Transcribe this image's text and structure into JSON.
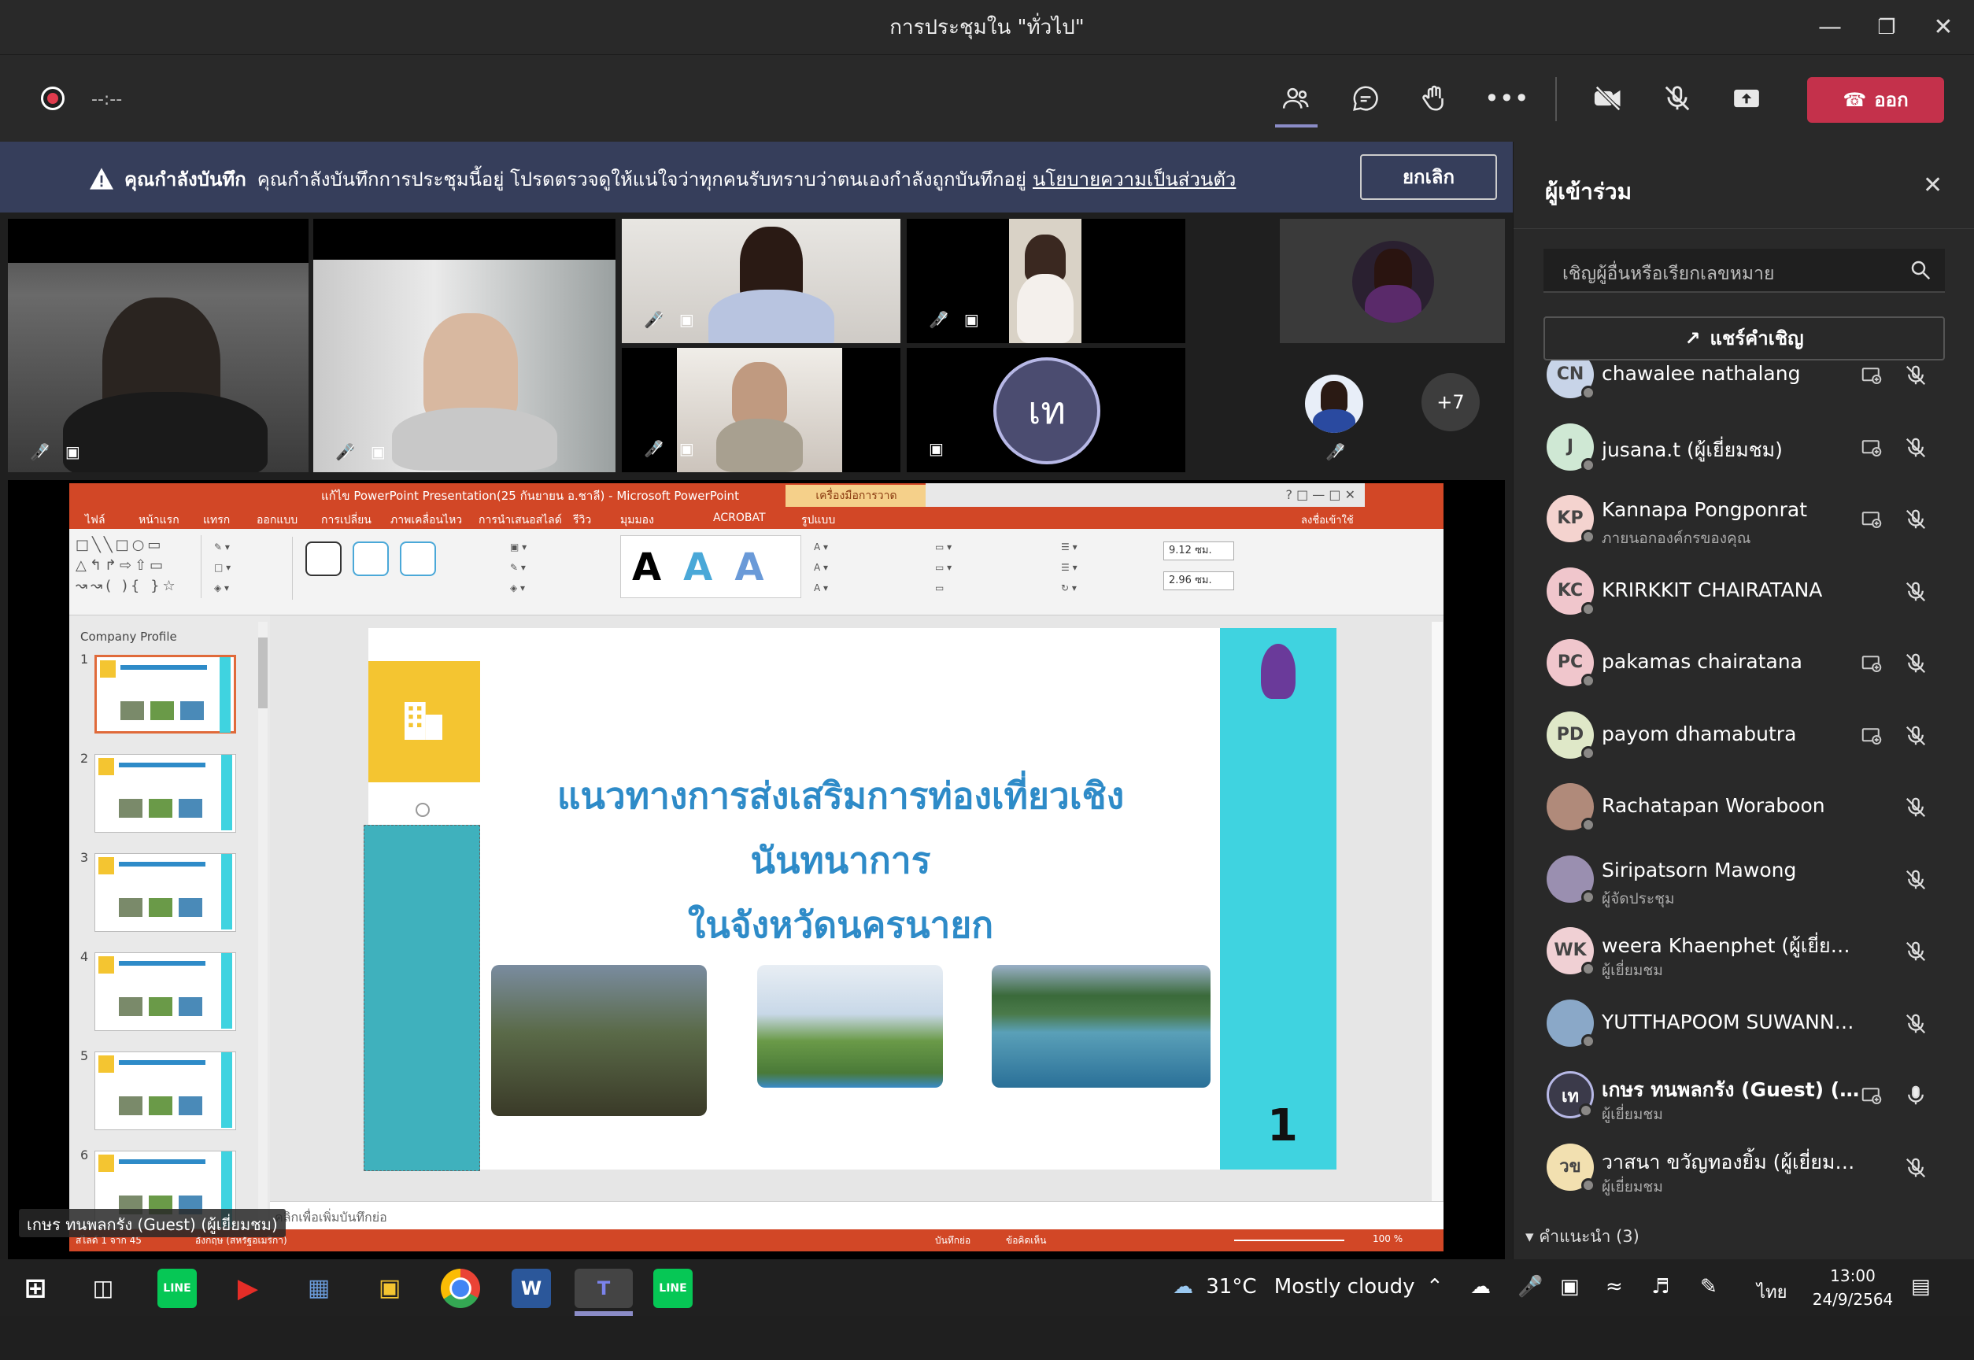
{
  "window": {
    "title": "การประชุมใน \"ทั่วไป\""
  },
  "toolbar": {
    "timer": "--:--",
    "leave_label": "ออก"
  },
  "banner": {
    "bold": "คุณกำลังบันทึก",
    "text": "คุณกำลังบันทึกการประชุมนี้อยู่ โปรดตรวจดูให้แน่ใจว่าทุกคนรับทราบว่าตนเองกำลังถูกบันทึกอยู่",
    "link": "นโยบายความเป็นส่วนตัว",
    "cancel_label": "ยกเลิก"
  },
  "gallery": {
    "initials_tile": "เท",
    "overflow": "+7"
  },
  "presenter_label": "เกษร ทนพลกรัง (Guest) (ผู้เยี่ยมชม)",
  "powerpoint": {
    "window_title": "แก้ไข PowerPoint Presentation(25 กันยายน อ.ชาลี) - Microsoft PowerPoint",
    "context_tab": "เครื่องมือการวาด",
    "tabs": [
      "ไฟล์",
      "หน้าแรก",
      "แทรก",
      "ออกแบบ",
      "การเปลี่ยน",
      "ภาพเคลื่อนไหว",
      "การนำเสนอสไลด์",
      "รีวิว",
      "มุมมอง",
      "ACROBAT",
      "รูปแบบ"
    ],
    "signin": "ลงชื่อเข้าใช้",
    "size_w": "9.12 ซม.",
    "size_h": "2.96 ซม.",
    "section_name": "Company Profile",
    "thumb_numbers": [
      "1",
      "2",
      "3",
      "4",
      "5",
      "6"
    ],
    "slide_title_line1": "แนวทางการส่งเสริมการท่องเที่ยวเชิงนันทนาการ",
    "slide_title_line2": "ในจังหวัดนครนายก",
    "slide_number": "1",
    "notes_placeholder": "คลิกเพื่อเพิ่มบันทึกย่อ",
    "status_left": "สไลด์ 1 จาก 45",
    "status_theme": "อังกฤษ (สหรัฐอเมริกา)",
    "status_notes": "บันทึกย่อ",
    "status_comments": "ข้อคิดเห็น",
    "zoom": "100 %"
  },
  "panel": {
    "title": "ผู้เข้าร่วม",
    "search_placeholder": "เชิญผู้อื่นหรือเรียกเลขหมาย",
    "share_label": "แชร์คำเชิญ",
    "participants": [
      {
        "initials": "CN",
        "name": "chawalee nathalang",
        "sub": "",
        "color": "#c8d4e8"
      },
      {
        "initials": "J",
        "name": "jusana.t (ผู้เยี่ยมชม)",
        "sub": "",
        "color": "#cfe8d4"
      },
      {
        "initials": "KP",
        "name": "Kannapa Pongponrat",
        "sub": "ภายนอกองค์กรของคุณ",
        "color": "#f4d3cf"
      },
      {
        "initials": "KC",
        "name": "KRIRKKIT CHAIRATANA",
        "sub": "",
        "color": "#f0c6cc"
      },
      {
        "initials": "PC",
        "name": "pakamas chairatana",
        "sub": "",
        "color": "#f0c6cc"
      },
      {
        "initials": "PD",
        "name": "payom dhamabutra",
        "sub": "",
        "color": "#dfe8c8"
      },
      {
        "initials": "",
        "name": "Rachatapan Woraboon",
        "sub": "",
        "color": "#b08a7a"
      },
      {
        "initials": "",
        "name": "Siripatsorn Mawong",
        "sub": "ผู้จัดประชุม",
        "color": "#9a8fb0"
      },
      {
        "initials": "WK",
        "name": "weera Khaenphet (ผู้เยี่ยมชม)",
        "sub": "ผู้เยี่ยมชม",
        "color": "#f0d0d4"
      },
      {
        "initials": "",
        "name": "YUTTHAPOOM SUWANNAVEJ",
        "sub": "",
        "color": "#8aa8c8"
      },
      {
        "initials": "เท",
        "name": "เกษร ทนพลกรัง (Guest) (...",
        "sub": "ผู้เยี่ยมชม",
        "color": "#3b3a4a"
      },
      {
        "initials": "วข",
        "name": "วาสนา ขวัญทองยิ้ม (ผู้เยี่ยมชม)",
        "sub": "ผู้เยี่ยมชม",
        "color": "#f2e0b0"
      }
    ],
    "section_label": "คำแนะนำ (3)"
  },
  "taskbar": {
    "weather_temp": "31°C",
    "weather_text": "Mostly cloudy",
    "language": "ไทย",
    "time": "13:00",
    "date": "24/9/2564"
  },
  "colors": {
    "accent": "#6264a7",
    "leave": "#c4314b",
    "ppt": "#d24726",
    "banner": "#363e5b"
  }
}
